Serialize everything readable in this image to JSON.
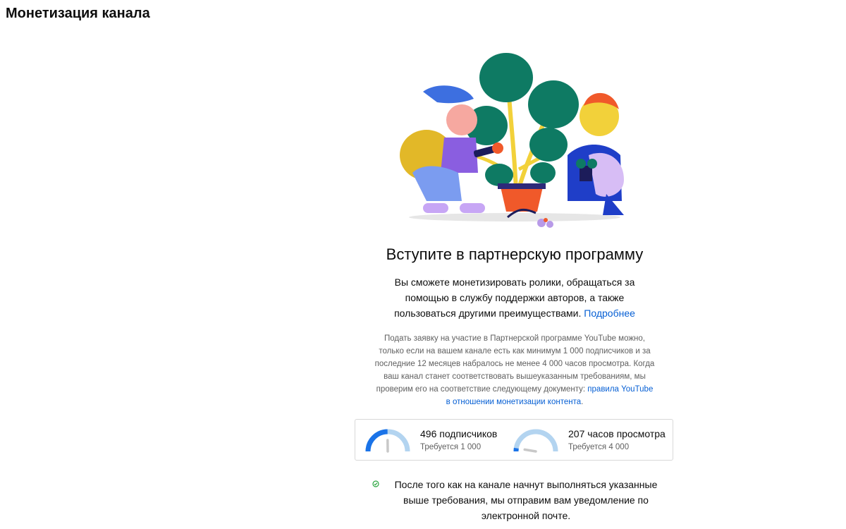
{
  "page": {
    "title": "Монетизация канала"
  },
  "promo": {
    "headline": "Вступите в партнерскую программу",
    "lead_text": "Вы сможете монетизировать ролики, обращаться за помощью в службу поддержки авторов, а также пользоваться другими преимуществами.",
    "lead_link": "Подробнее",
    "note_text": "Подать заявку на участие в Партнерской программе YouTube можно, только если на вашем канале есть как минимум 1 000 подписчиков и за последние 12 месяцев набралось не менее 4 000 часов просмотра. Когда ваш канал станет соответствовать вышеуказанным требованиям, мы проверим его на соответствие следующему документу:",
    "note_link": "правила YouTube в отношении монетизации контента",
    "note_end": "."
  },
  "stats": {
    "subscribers": {
      "value": "496 подписчиков",
      "required": "Требуется 1 000",
      "progress": 0.496
    },
    "watch_hours": {
      "value": "207 часов просмотра",
      "required": "Требуется 4 000",
      "progress": 0.052
    }
  },
  "notification": {
    "icon": "check-circle-icon",
    "text": "После того как на канале начнут выполняться указанные выше требования, мы отправим вам уведомление по электронной почте."
  },
  "colors": {
    "accent": "#065fd4",
    "gauge_fill": "#1a73e8",
    "gauge_track": "#b3d4f0",
    "success": "#2ba640"
  }
}
